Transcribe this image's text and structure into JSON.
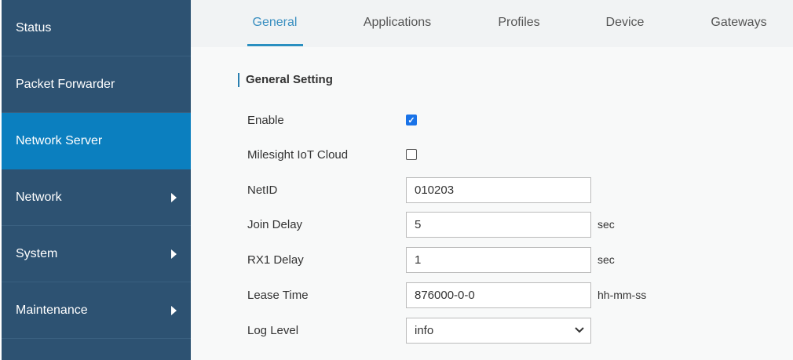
{
  "sidebar": {
    "items": [
      {
        "label": "Status"
      },
      {
        "label": "Packet Forwarder"
      },
      {
        "label": "Network Server",
        "active": true
      },
      {
        "label": "Network",
        "submenu": true
      },
      {
        "label": "System",
        "submenu": true
      },
      {
        "label": "Maintenance",
        "submenu": true
      }
    ]
  },
  "tabs": [
    "General",
    "Applications",
    "Profiles",
    "Device",
    "Gateways"
  ],
  "section_title": "General Setting",
  "form": {
    "enable": {
      "label": "Enable",
      "checked": true
    },
    "cloud": {
      "label": "Milesight IoT Cloud",
      "checked": false
    },
    "netid": {
      "label": "NetID",
      "value": "010203"
    },
    "join_delay": {
      "label": "Join Delay",
      "value": "5",
      "unit": "sec"
    },
    "rx1_delay": {
      "label": "RX1 Delay",
      "value": "1",
      "unit": "sec"
    },
    "lease_time": {
      "label": "Lease Time",
      "value": "876000-0-0",
      "unit": "hh-mm-ss"
    },
    "log_level": {
      "label": "Log Level",
      "value": "info"
    }
  }
}
